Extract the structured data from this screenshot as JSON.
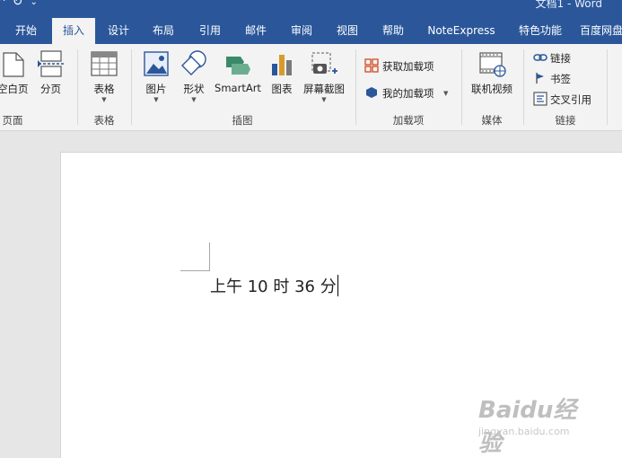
{
  "title_bar": {
    "doc_title": "文档1 - Word"
  },
  "tabs": [
    {
      "label": "开始",
      "active": false
    },
    {
      "label": "插入",
      "active": true
    },
    {
      "label": "设计",
      "active": false
    },
    {
      "label": "布局",
      "active": false
    },
    {
      "label": "引用",
      "active": false
    },
    {
      "label": "邮件",
      "active": false
    },
    {
      "label": "审阅",
      "active": false
    },
    {
      "label": "视图",
      "active": false
    },
    {
      "label": "帮助",
      "active": false
    },
    {
      "label": "NoteExpress",
      "active": false
    },
    {
      "label": "特色功能",
      "active": false
    },
    {
      "label": "百度网盘",
      "active": false
    }
  ],
  "ribbon": {
    "groups": {
      "pages": {
        "label": "页面",
        "blank_page": "空白页",
        "page_break": "分页"
      },
      "tables": {
        "label": "表格",
        "table": "表格"
      },
      "illustrations": {
        "label": "插图",
        "pictures": "图片",
        "shapes": "形状",
        "smartart": "SmartArt",
        "chart": "图表",
        "screenshot": "屏幕截图"
      },
      "addins": {
        "label": "加载项",
        "get_addins": "获取加载项",
        "my_addins": "我的加载项"
      },
      "media": {
        "label": "媒体",
        "online_video": "联机视频"
      },
      "links": {
        "label": "链接",
        "link": "链接",
        "bookmark": "书签",
        "cross_reference": "交叉引用"
      }
    }
  },
  "document": {
    "text": "上午 10 时 36 分"
  },
  "watermark": {
    "text": "Baidu经验",
    "url": "jingyan.baidu.com"
  },
  "colors": {
    "accent": "#2b579a",
    "ribbon_bg": "#f3f3f3",
    "canvas_bg": "#e6e6e6"
  }
}
